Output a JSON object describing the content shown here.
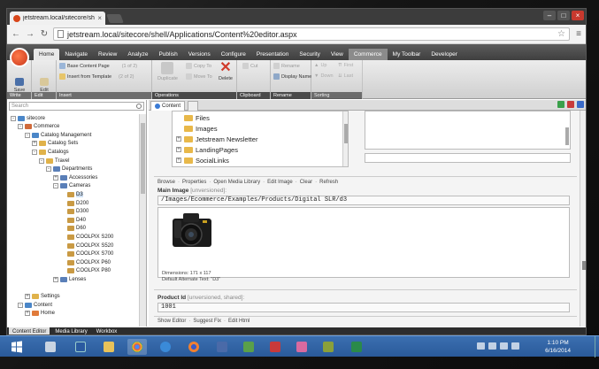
{
  "browser": {
    "tab_title": "jetstream.local/sitecore/sh",
    "url": "jetstream.local/sitecore/shell/Applications/Content%20editor.aspx"
  },
  "ribbon": {
    "tabs": [
      "Home",
      "Navigate",
      "Review",
      "Analyze",
      "Publish",
      "Versions",
      "Configure",
      "Presentation",
      "Security",
      "View",
      "Commerce",
      "My Toolbar",
      "Developer"
    ],
    "active_tab": "Home",
    "groups": {
      "write": {
        "label": "Write",
        "save": "Save"
      },
      "edit": {
        "label": "Edit",
        "edit": "Edit"
      },
      "insert": {
        "label": "Insert",
        "items": [
          {
            "label": "Base Content Page",
            "count": "(1 of 2)"
          },
          {
            "label": "Insert from Template",
            "count": "(2 of 2)"
          }
        ]
      },
      "operations": {
        "label": "Operations",
        "duplicate": "Duplicate",
        "copy_to": "Copy To",
        "move_to": "Move To",
        "delete": "Delete"
      },
      "clipboard": {
        "label": "Clipboard",
        "cut": "Cut"
      },
      "rename": {
        "label": "Rename",
        "rename": "Rename",
        "display_name": "Display Name"
      },
      "sorting": {
        "label": "Sorting",
        "up": "Up",
        "down": "Down",
        "first": "First",
        "last": "Last"
      }
    }
  },
  "left_panel": {
    "search_placeholder": "Search",
    "tree": [
      {
        "label": "sitecore",
        "depth": 0,
        "toggle": "-",
        "color": "#4a86c8"
      },
      {
        "label": "Commerce",
        "depth": 1,
        "toggle": "-",
        "color": "#d06a3a"
      },
      {
        "label": "Catalog Management",
        "depth": 2,
        "toggle": "-",
        "color": "#4a86c8"
      },
      {
        "label": "Catalog Sets",
        "depth": 3,
        "toggle": "+",
        "color": "#e0b24a"
      },
      {
        "label": "Catalogs",
        "depth": 3,
        "toggle": "-",
        "color": "#e0b24a"
      },
      {
        "label": "Travel",
        "depth": 4,
        "toggle": "-",
        "color": "#e0b24a"
      },
      {
        "label": "Departments",
        "depth": 5,
        "toggle": "-",
        "color": "#5a7fb8"
      },
      {
        "label": "Accessories",
        "depth": 6,
        "toggle": "+",
        "color": "#5a7fb8"
      },
      {
        "label": "Cameras",
        "depth": 6,
        "toggle": "-",
        "color": "#5a7fb8"
      },
      {
        "label": "D3",
        "depth": 7,
        "toggle": "",
        "color": "#c99a44",
        "selected": true
      },
      {
        "label": "D200",
        "depth": 7,
        "toggle": "",
        "color": "#c99a44"
      },
      {
        "label": "D300",
        "depth": 7,
        "toggle": "",
        "color": "#c99a44"
      },
      {
        "label": "D40",
        "depth": 7,
        "toggle": "",
        "color": "#c99a44"
      },
      {
        "label": "D60",
        "depth": 7,
        "toggle": "",
        "color": "#c99a44"
      },
      {
        "label": "COOLPIX S200",
        "depth": 7,
        "toggle": "",
        "color": "#c99a44"
      },
      {
        "label": "COOLPIX S520",
        "depth": 7,
        "toggle": "",
        "color": "#c99a44"
      },
      {
        "label": "COOLPIX S700",
        "depth": 7,
        "toggle": "",
        "color": "#c99a44"
      },
      {
        "label": "COOLPIX P60",
        "depth": 7,
        "toggle": "",
        "color": "#c99a44"
      },
      {
        "label": "COOLPIX P80",
        "depth": 7,
        "toggle": "",
        "color": "#c99a44"
      },
      {
        "label": "Lenses",
        "depth": 6,
        "toggle": "+",
        "color": "#5a7fb8"
      },
      {
        "label": "",
        "depth": 0,
        "toggle": "",
        "color": ""
      },
      {
        "label": "Settings",
        "depth": 2,
        "toggle": "+",
        "color": "#e0b24a"
      },
      {
        "label": "Content",
        "depth": 1,
        "toggle": "-",
        "color": "#4a86c8"
      },
      {
        "label": "Home",
        "depth": 2,
        "toggle": "+",
        "color": "#e07a3a"
      }
    ]
  },
  "bottom_tabs": [
    "Content Editor",
    "Media Library",
    "Workbox"
  ],
  "content": {
    "tab_label": "Content",
    "tree_items": [
      {
        "label": "Files",
        "toggle": ""
      },
      {
        "label": "Images",
        "toggle": ""
      },
      {
        "label": "Jetstream Newsletter",
        "toggle": "+"
      },
      {
        "label": "LandingPages",
        "toggle": "+"
      },
      {
        "label": "SocialLinks",
        "toggle": "+"
      }
    ],
    "image_toolbar": [
      "Browse",
      "Properties",
      "Open Media Library",
      "Edit Image",
      "Clear",
      "Refresh"
    ],
    "main_image": {
      "label": "Main Image",
      "qualifier": "[unversioned]:",
      "path": "/Images/Ecommerce/Examples/Products/Digital SLR/d3",
      "dimensions": "Dimensions: 171 x 117",
      "alt_text": "Default Alternate Text: \"D3\""
    },
    "product_id": {
      "label": "Product Id",
      "qualifier": "[unversioned, shared]:",
      "value": "1001"
    },
    "footer_links": [
      "Show Editor",
      "Suggest Fix",
      "Edit Html"
    ]
  },
  "taskbar": {
    "time": "1:10 PM",
    "date": "6/16/2014",
    "apps": [
      "start",
      "server-manager",
      "powershell",
      "file-explorer",
      "chrome",
      "internet-explorer",
      "firefox",
      "app-blue",
      "app-green",
      "app-red",
      "app-pink",
      "app-olive",
      "app-excel"
    ]
  }
}
